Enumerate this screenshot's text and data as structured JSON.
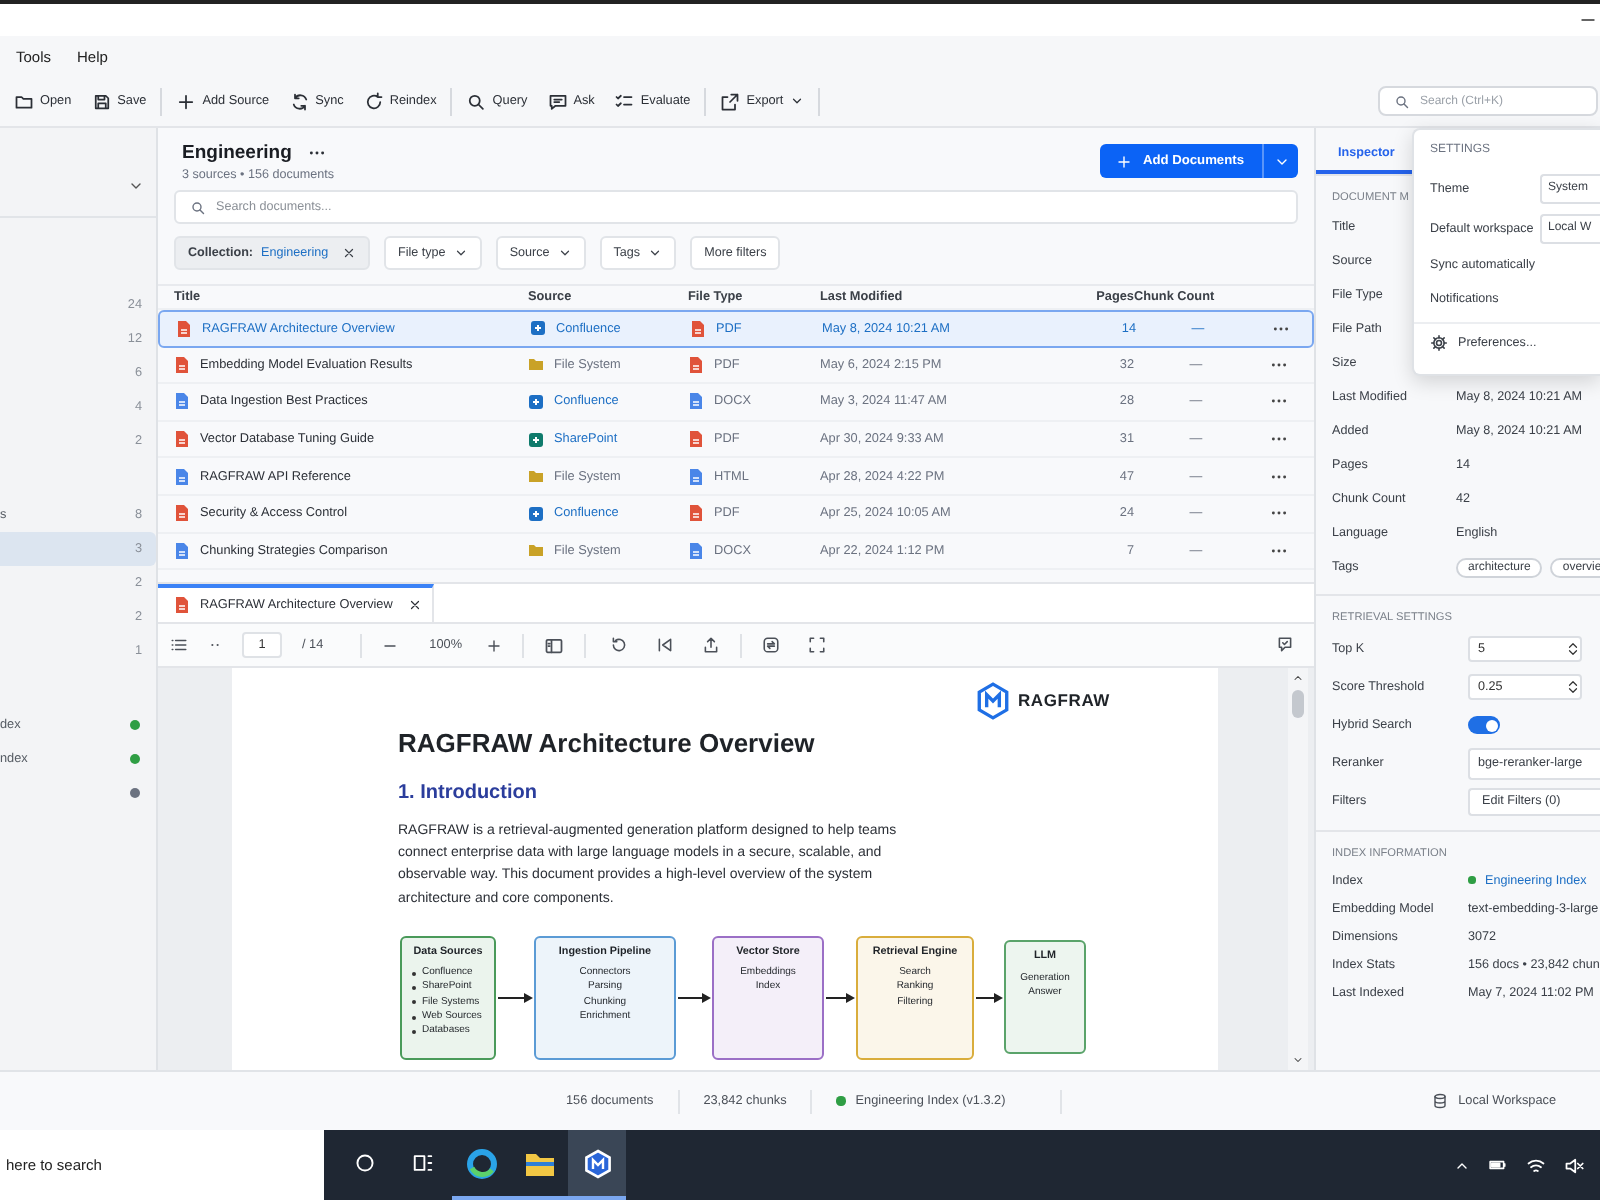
{
  "menu": [
    {
      "label": "Tools"
    },
    {
      "label": "Help"
    }
  ],
  "toolbar": {
    "groups": [
      [
        {
          "label": "Open"
        },
        {
          "label": "Save"
        }
      ],
      [
        {
          "label": "Add Source"
        },
        {
          "label": "Sync"
        },
        {
          "label": "Reindex"
        }
      ],
      [
        {
          "label": "Query"
        },
        {
          "label": "Ask"
        },
        {
          "label": "Evaluate"
        }
      ],
      [
        {
          "label": "Export",
          "menu": true
        }
      ]
    ],
    "search": {
      "placeholder": "Search (Ctrl+K)"
    }
  },
  "sidebar": {
    "groups": [
      {
        "items": [
          {
            "count": "24",
            "selected": false
          },
          {
            "count": "12",
            "selected": false
          },
          {
            "count": "6",
            "selected": false
          },
          {
            "count": "4",
            "selected": false
          },
          {
            "count": "2",
            "selected": false
          }
        ]
      },
      {
        "items": [
          {
            "label": "s",
            "count": "8",
            "selected": false
          },
          {
            "count": "3",
            "selected": true
          },
          {
            "count": "2",
            "selected": false
          },
          {
            "count": "2",
            "selected": false
          },
          {
            "count": "1",
            "selected": false
          }
        ]
      }
    ],
    "indexes": [
      {
        "label": "dex",
        "color": "#2f9e44"
      },
      {
        "label": "ndex",
        "color": "#2f9e44"
      },
      {
        "color": "#6b7280"
      }
    ]
  },
  "collection": {
    "title": "Engineering",
    "subtitle": "3 sources • 156 documents",
    "action": "Add Documents"
  },
  "doc_search": {
    "placeholder": "Search documents..."
  },
  "filters": [
    {
      "kind": "chip",
      "label": "Collection:",
      "value": "Engineering"
    },
    {
      "kind": "dropdown",
      "label": "File type"
    },
    {
      "kind": "dropdown",
      "label": "Source"
    },
    {
      "kind": "dropdown",
      "label": "Tags"
    },
    {
      "kind": "button",
      "label": "More filters"
    }
  ],
  "table": {
    "columns": [
      "Title",
      "Source",
      "File Type",
      "Last Modified",
      "Pages",
      "Chunk Count"
    ],
    "rows": [
      {
        "title": "RAGFRAW Architecture Overview",
        "source": {
          "label": "Confluence",
          "kind": "link",
          "color": "#1d6fc4"
        },
        "file_type": {
          "label": "PDF",
          "color": "#e0533a"
        },
        "modified": "May 8, 2024  10:21 AM",
        "pages": "14",
        "chunks": "—",
        "selected": true
      },
      {
        "title": "Embedding Model Evaluation Results",
        "source": {
          "label": "File System",
          "kind": "folder",
          "color": "#c9a227"
        },
        "file_type": {
          "label": "PDF",
          "color": "#e0533a"
        },
        "modified": "May 6, 2024  2:15 PM",
        "pages": "32",
        "chunks": "—",
        "selected": false
      },
      {
        "title": "Data Ingestion Best Practices",
        "source": {
          "label": "Confluence",
          "kind": "link",
          "color": "#1d6fc4"
        },
        "file_type": {
          "label": "DOCX",
          "color": "#4a86e8"
        },
        "modified": "May 3, 2024  11:47 AM",
        "pages": "28",
        "chunks": "—",
        "selected": false
      },
      {
        "title": "Vector Database Tuning Guide",
        "source": {
          "label": "SharePoint",
          "kind": "link",
          "color": "#0f7b6c"
        },
        "file_type": {
          "label": "PDF",
          "color": "#e0533a"
        },
        "modified": "Apr 30, 2024  9:33 AM",
        "pages": "31",
        "chunks": "—",
        "selected": false
      },
      {
        "title": "RAGFRAW API Reference",
        "source": {
          "label": "File System",
          "kind": "folder",
          "color": "#c9a227"
        },
        "file_type": {
          "label": "HTML",
          "color": "#4a86e8"
        },
        "modified": "Apr 28, 2024  4:22 PM",
        "pages": "47",
        "chunks": "—",
        "selected": false
      },
      {
        "title": "Security & Access Control",
        "source": {
          "label": "Confluence",
          "kind": "link",
          "color": "#1d6fc4"
        },
        "file_type": {
          "label": "PDF",
          "color": "#e0533a"
        },
        "modified": "Apr 25, 2024  10:05 AM",
        "pages": "24",
        "chunks": "—",
        "selected": false
      },
      {
        "title": "Chunking Strategies Comparison",
        "source": {
          "label": "File System",
          "kind": "folder",
          "color": "#c9a227"
        },
        "file_type": {
          "label": "DOCX",
          "color": "#4a86e8"
        },
        "modified": "Apr 22, 2024  1:12 PM",
        "pages": "7",
        "chunks": "—",
        "selected": false
      }
    ]
  },
  "viewer": {
    "tab": "RAGFRAW Architecture Overview",
    "page": "1",
    "total": "/ 14",
    "zoom": "100%"
  },
  "document": {
    "brand": "RAGFRAW",
    "title": "RAGFRAW Architecture Overview",
    "heading": "1. Introduction",
    "paragraph": "RAGFRAW is a retrieval-augmented generation platform designed to help teams connect enterprise data with large language models in a secure, scalable, and observable way. This document provides a high-level overview of the system architecture and core components.",
    "diagram": [
      {
        "title": "Data Sources",
        "kind": "bullets",
        "color": "#4a9a5a",
        "items": [
          "Confluence",
          "SharePoint",
          "File Systems",
          "Web Sources",
          "Databases"
        ]
      },
      {
        "title": "Ingestion Pipeline",
        "kind": "plain",
        "color": "#5b9bd5",
        "items": [
          "Connectors",
          "Parsing",
          "Chunking",
          "Enrichment"
        ]
      },
      {
        "title": "Vector Store",
        "kind": "plain",
        "color": "#9b6fc6",
        "items": [
          "Embeddings",
          "Index"
        ]
      },
      {
        "title": "Retrieval Engine",
        "kind": "plain",
        "color": "#d9ad3c",
        "items": [
          "Search",
          "Ranking",
          "Filtering"
        ]
      },
      {
        "title": "LLM",
        "kind": "plain",
        "color": "#5aa36a",
        "items": [
          "Generation",
          "Answer"
        ]
      }
    ]
  },
  "inspector": {
    "tabs": [
      {
        "label": "Inspector",
        "selected": true
      }
    ],
    "section": "DOCUMENT M",
    "metadata": [
      {
        "label": "Title"
      },
      {
        "label": "Source"
      },
      {
        "label": "File Type"
      },
      {
        "label": "File Path"
      },
      {
        "label": "Size"
      },
      {
        "label": "Last Modified",
        "value": "May 8, 2024  10:21 AM"
      },
      {
        "label": "Added",
        "value": "May 8, 2024  10:21 AM"
      },
      {
        "label": "Pages",
        "value": "14"
      },
      {
        "label": "Chunk Count",
        "value": "42"
      },
      {
        "label": "Language",
        "value": "English"
      },
      {
        "label": "Tags",
        "tags": [
          "architecture",
          "overvie"
        ]
      }
    ],
    "retrieval": {
      "title": "RETRIEVAL SETTINGS",
      "fields": [
        {
          "kind": "spinner",
          "label": "Top K",
          "value": "5"
        },
        {
          "kind": "spinner",
          "label": "Score Threshold",
          "value": "0.25"
        },
        {
          "kind": "toggle",
          "label": "Hybrid Search",
          "on": true
        },
        {
          "kind": "select",
          "label": "Reranker",
          "value": "bge-reranker-large"
        },
        {
          "kind": "button",
          "label": "Filters",
          "value": "Edit Filters (0)"
        }
      ]
    },
    "index_info": {
      "title": "INDEX INFORMATION",
      "rows": [
        {
          "kind": "link",
          "label": "Index",
          "value": "Engineering Index",
          "color": "#2f9e44"
        },
        {
          "kind": "text",
          "label": "Embedding Model",
          "value": "text-embedding-3-large"
        },
        {
          "kind": "text",
          "label": "Dimensions",
          "value": "3072"
        },
        {
          "kind": "text",
          "label": "Index Stats",
          "value": "156 docs • 23,842 chun"
        },
        {
          "kind": "text",
          "label": "Last Indexed",
          "value": "May 7, 2024  11:02 PM"
        }
      ]
    }
  },
  "settings": {
    "title": "SETTINGS",
    "rows": [
      {
        "kind": "select",
        "label": "Theme",
        "value": "System"
      },
      {
        "kind": "select",
        "label": "Default workspace",
        "value": "Local W"
      },
      {
        "kind": "item",
        "label": "Sync automatically"
      },
      {
        "kind": "item",
        "label": "Notifications"
      },
      {
        "kind": "link",
        "label": "Preferences..."
      }
    ]
  },
  "status": {
    "documents": "156 documents",
    "chunks": "23,842 chunks",
    "index": {
      "label": "Engineering Index (v1.3.2)",
      "color": "#2f9e44"
    },
    "workspace": "Local Workspace"
  },
  "taskbar": {
    "search": {
      "placeholder": "here to search"
    },
    "apps": [
      {
        "running": true,
        "selected": false
      },
      {
        "running": true,
        "selected": false
      },
      {
        "running": true,
        "selected": true
      }
    ]
  }
}
